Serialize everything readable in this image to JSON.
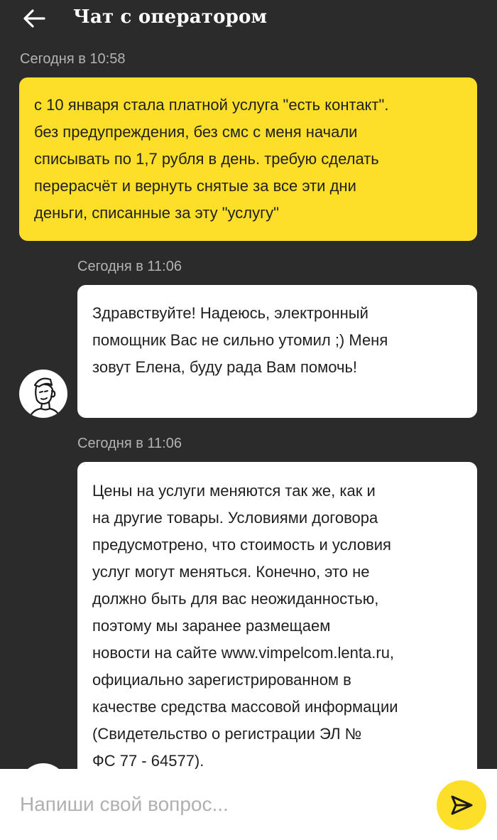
{
  "header": {
    "title": "Чат с оператором",
    "back_icon": "arrow-left-icon"
  },
  "messages": [
    {
      "sender": "user",
      "time": "Сегодня в 10:58",
      "lines": [
        "с 10 января стала платной услуга \"есть контакт\".",
        "без предупреждения, без смс с меня начали",
        "списывать по 1,7 рубля в день. требую сделать",
        "перерасчёт и вернуть снятые за все эти дни",
        "деньги, списанные за эту \"услугу\""
      ]
    },
    {
      "sender": "operator",
      "time": "Сегодня в 11:06",
      "lines": [
        "Здравствуйте! Надеюсь, электронный",
        "помощник Вас не сильно утомил ;) Меня",
        "зовут Елена, буду рада Вам помочь!"
      ]
    },
    {
      "sender": "operator",
      "time": "Сегодня в 11:06",
      "lines": [
        "Цены на услуги меняются так же, как и",
        "на другие товары. Условиями договора",
        "предусмотрено, что стоимость и условия",
        "услуг могут меняться. Конечно, это не",
        "должно быть для вас неожиданностью,",
        "поэтому мы заранее размещаем",
        "новости на сайте www.vimpelcom.lenta.ru,",
        "официально зарегистрированном в",
        "качестве средства массовой информации",
        "(Свидетельство о регистрации ЭЛ №",
        "ФС 77 - 64577)."
      ]
    }
  ],
  "composer": {
    "placeholder": "Напиши свой вопрос...",
    "value": "",
    "send_icon": "send-icon"
  },
  "colors": {
    "background": "#2b2b2b",
    "user_bubble": "#fddf2a",
    "operator_bubble": "#ffffff",
    "timestamp": "#b3b3b3",
    "accent": "#fddf2a"
  }
}
